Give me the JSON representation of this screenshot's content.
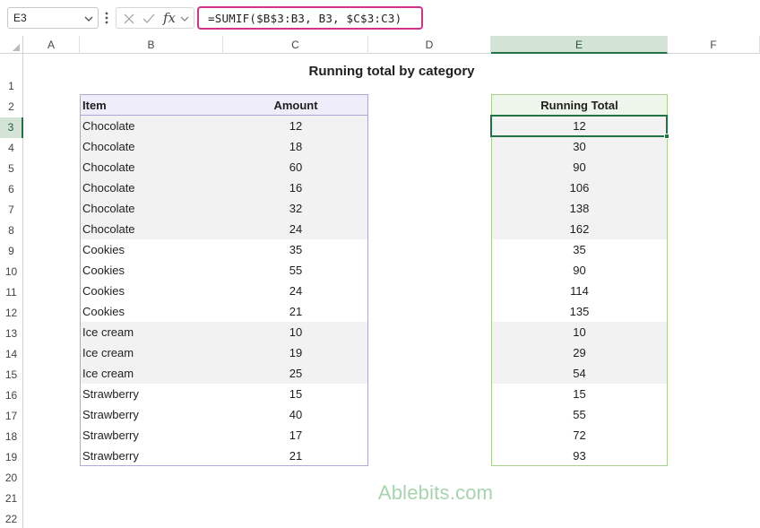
{
  "name_box": "E3",
  "formula": "=SUMIF($B$3:B3, B3, $C$3:C3)",
  "icons": {
    "namebox_caret": "chevron-down-icon",
    "menu": "vertical-dots-icon",
    "cancel": "x-icon",
    "enter": "check-icon",
    "function": "fx-icon"
  },
  "fx_label": "fx",
  "columns": [
    "A",
    "B",
    "C",
    "D",
    "E",
    "F"
  ],
  "selected_column": "E",
  "rows": [
    "1",
    "2",
    "3",
    "4",
    "5",
    "6",
    "7",
    "8",
    "9",
    "10",
    "11",
    "12",
    "13",
    "14",
    "15",
    "16",
    "17",
    "18",
    "19",
    "20",
    "21",
    "22"
  ],
  "selected_row": "3",
  "title": "Running total by category",
  "table": {
    "headers": {
      "item": "Item",
      "amount": "Amount"
    },
    "rows": [
      {
        "item": "Chocolate",
        "amount": "12"
      },
      {
        "item": "Chocolate",
        "amount": "18"
      },
      {
        "item": "Chocolate",
        "amount": "60"
      },
      {
        "item": "Chocolate",
        "amount": "16"
      },
      {
        "item": "Chocolate",
        "amount": "32"
      },
      {
        "item": "Chocolate",
        "amount": "24"
      },
      {
        "item": "Cookies",
        "amount": "35"
      },
      {
        "item": "Cookies",
        "amount": "55"
      },
      {
        "item": "Cookies",
        "amount": "24"
      },
      {
        "item": "Cookies",
        "amount": "21"
      },
      {
        "item": "Ice cream",
        "amount": "10"
      },
      {
        "item": "Ice cream",
        "amount": "19"
      },
      {
        "item": "Ice cream",
        "amount": "25"
      },
      {
        "item": "Strawberry",
        "amount": "15"
      },
      {
        "item": "Strawberry",
        "amount": "40"
      },
      {
        "item": "Strawberry",
        "amount": "17"
      },
      {
        "item": "Strawberry",
        "amount": "21"
      }
    ]
  },
  "running_total": {
    "header": "Running Total",
    "values": [
      "12",
      "30",
      "90",
      "106",
      "138",
      "162",
      "35",
      "90",
      "114",
      "135",
      "10",
      "29",
      "54",
      "15",
      "55",
      "72",
      "93"
    ]
  },
  "watermark": "Ablebits.com",
  "colors": {
    "formula_border": "#d2338b",
    "selection": "#217346",
    "band": "#f2f2f2",
    "table1_border": "#b4a7d6",
    "table2_border": "#a9d08e",
    "watermark": "#a7d3ae"
  }
}
